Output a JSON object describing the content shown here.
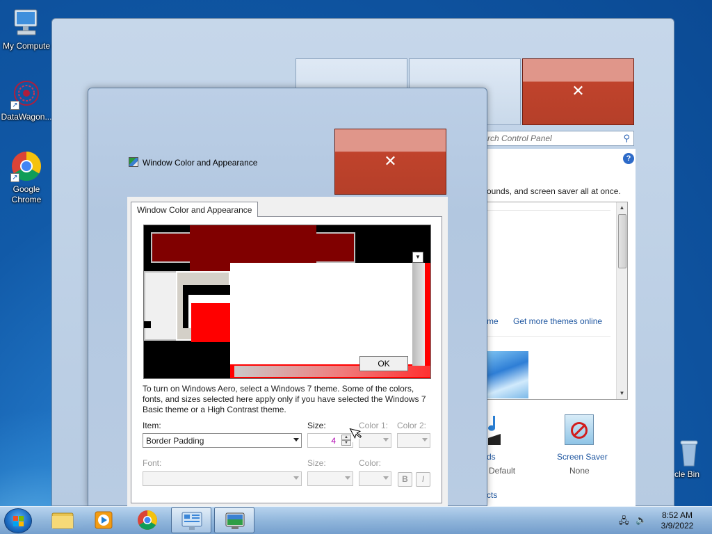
{
  "desktop": {
    "icons": [
      {
        "label": "My Compute"
      },
      {
        "label": "DataWagon..."
      },
      {
        "label": "Google Chrome"
      },
      {
        "label": "cle Bin"
      }
    ]
  },
  "background_window": {
    "search_placeholder": "rch Control Panel",
    "help_glyph": "?",
    "description": "ounds, and screen saver all at once.",
    "link_theme": "me",
    "link_more_themes": "Get more themes online",
    "sounds_label": "ds",
    "sounds_value": "Default",
    "screen_saver_label": "Screen Saver",
    "screen_saver_value": "None",
    "bottom_link": "cts"
  },
  "dialog": {
    "title": "Window Color and Appearance",
    "tab_label": "Window Color and Appearance",
    "preview_ok": "OK",
    "instructions": "To turn on Windows Aero, select a Windows 7 theme.  Some of the colors, fonts, and sizes selected here apply only if you have selected the Windows 7 Basic theme or a High Contrast theme.",
    "item_label": "Item:",
    "item_value": "Border Padding",
    "size_label": "Size:",
    "size_value": "4",
    "color1_label": "Color 1:",
    "color2_label": "Color 2:",
    "font_label": "Font:",
    "font_size_label": "Size:",
    "font_color_label": "Color:",
    "bold_label": "B",
    "italic_label": "I"
  },
  "taskbar": {
    "time": "8:52 AM",
    "date": "3/9/2022"
  },
  "colors": {
    "preview_dark_red": "#800000",
    "preview_red": "#ff0000",
    "close_red": "#c0432c"
  }
}
